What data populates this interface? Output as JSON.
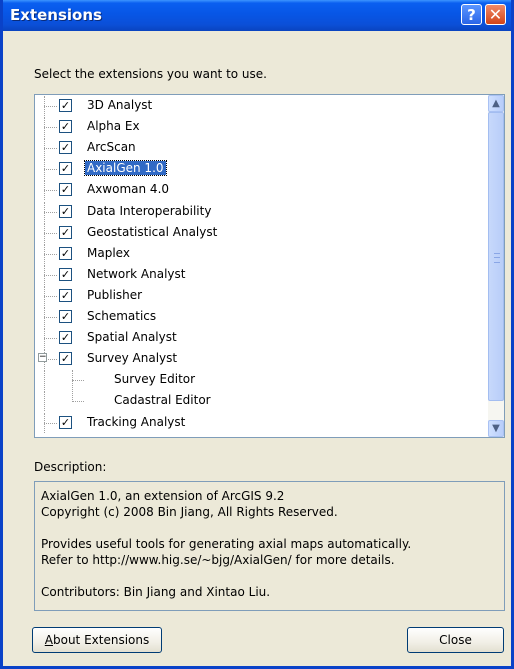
{
  "window": {
    "title": "Extensions"
  },
  "prompt": "Select the extensions you want to use.",
  "extensions": [
    {
      "label": "3D Analyst",
      "checked": true
    },
    {
      "label": "Alpha Ex",
      "checked": true
    },
    {
      "label": "ArcScan",
      "checked": true
    },
    {
      "label": "AxialGen 1.0",
      "checked": true,
      "selected": true
    },
    {
      "label": "Axwoman 4.0",
      "checked": true
    },
    {
      "label": "Data Interoperability",
      "checked": true
    },
    {
      "label": "Geostatistical Analyst",
      "checked": true
    },
    {
      "label": "Maplex",
      "checked": true
    },
    {
      "label": "Network Analyst",
      "checked": true
    },
    {
      "label": "Publisher",
      "checked": true
    },
    {
      "label": "Schematics",
      "checked": true
    },
    {
      "label": "Spatial Analyst",
      "checked": true
    },
    {
      "label": "Survey Analyst",
      "checked": true,
      "expanded": true
    },
    {
      "label": "Survey Editor",
      "child": true
    },
    {
      "label": "Cadastral Editor",
      "child": true
    },
    {
      "label": "Tracking Analyst",
      "checked": true
    }
  ],
  "description": {
    "label": "Description:",
    "lines": [
      "AxialGen 1.0, an extension of ArcGIS 9.2",
      "Copyright (c) 2008 Bin Jiang, All Rights Reserved.",
      "",
      "Provides useful tools for generating axial maps automatically.",
      "Refer to http://www.hig.se/~bjg/AxialGen/ for more details.",
      "",
      "Contributors: Bin Jiang and Xintao Liu."
    ]
  },
  "buttons": {
    "about_first": "A",
    "about_rest": "bout Extensions",
    "close": "Close"
  },
  "icons": {
    "help": "?",
    "close": "✕",
    "scroll_up": "▲",
    "scroll_down": "▼"
  }
}
